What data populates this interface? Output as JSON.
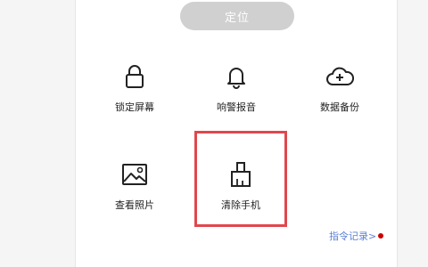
{
  "locate_button": {
    "label": "定位"
  },
  "actions": [
    {
      "label": "锁定屏幕",
      "icon": "lock-icon"
    },
    {
      "label": "响警报音",
      "icon": "bell-icon"
    },
    {
      "label": "数据备份",
      "icon": "cloud-add-icon"
    },
    {
      "label": "查看照片",
      "icon": "image-icon"
    },
    {
      "label": "清除手机",
      "icon": "brush-icon"
    }
  ],
  "command_log_link": {
    "label": "指令记录>"
  },
  "colors": {
    "highlight": "#e0474c",
    "link": "#5b7fd6",
    "button_bg": "#d0d0d0"
  }
}
